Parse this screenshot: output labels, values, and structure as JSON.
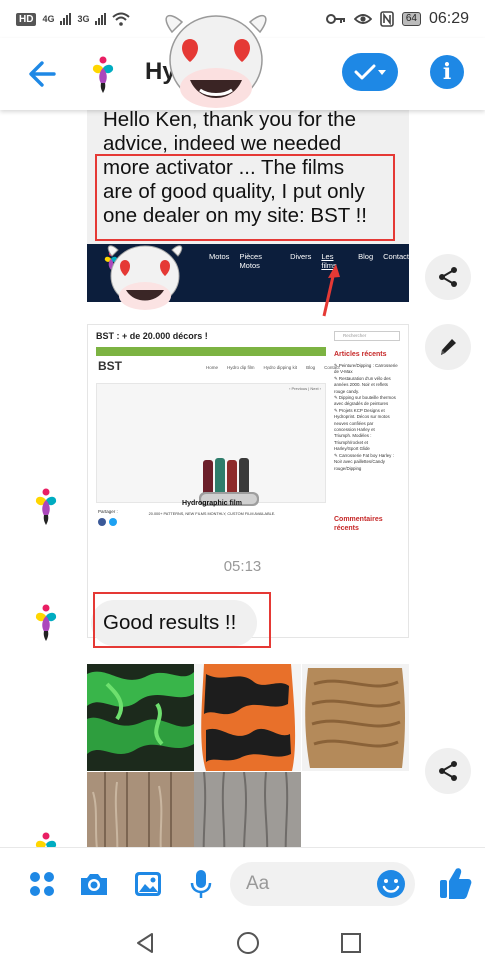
{
  "status_bar": {
    "hd_badge": "HD",
    "net1": "4G",
    "net2": "3G",
    "battery": "64",
    "time": "06:29"
  },
  "header": {
    "contact_name": "Hy",
    "accent_color": "#1e88e5"
  },
  "messages": {
    "incoming_text": "Hello Ken, thank you for the\nadvice, indeed we needed\nmore activator ... The films\nare of good quality, I put only\none dealer on my site: BST !!",
    "timestamp": "05:13",
    "good_results": "Good results !!"
  },
  "site_banner": {
    "nav": [
      "Motos",
      "Pièces Motos",
      "Divers",
      "Les films",
      "Blog",
      "Contact"
    ]
  },
  "site_screenshot": {
    "title": "BST : + de 20.000 décors !",
    "logo": "BST",
    "menu": [
      "Home",
      "Hydro dip film",
      "Hydro dipping kit",
      "Blog",
      "Contact"
    ],
    "slider_nav": "‹ Previous | Next ›",
    "product": "Hydrographic film",
    "tagline": "20.000+ PATTERNS, NEW FILMS MONTHLY, CUSTOM FILM AVAILABLE.",
    "share_label": "Partager :",
    "search_placeholder": "Rechercher",
    "recent_title": "Articles récents",
    "recent_items": "✎ Peinture/Dipping : Carrosserie\n   de V-Max\n✎ Restauration d'un vélo des\n   années 2000. Noir et reflets\n   rouge candy.\n✎ Dipping sur bouteille thermos\n   avec dégradés de peintures\n✎ Projets KCP Designs et\n   Hydroprint. Décos sur motos\n   neuves confiées par\n   concession Harley et\n   Triumph. Modèles :\n   Triumph/rocket et\n   Harley/Sport Glide\n✎ Carrosserie Fat boy Harley :\n   Noir avec paillettes/Candy\n   rouge/Dipping",
    "comments_title": "Commentaires\nrécents"
  },
  "composer": {
    "placeholder": "Aa"
  }
}
